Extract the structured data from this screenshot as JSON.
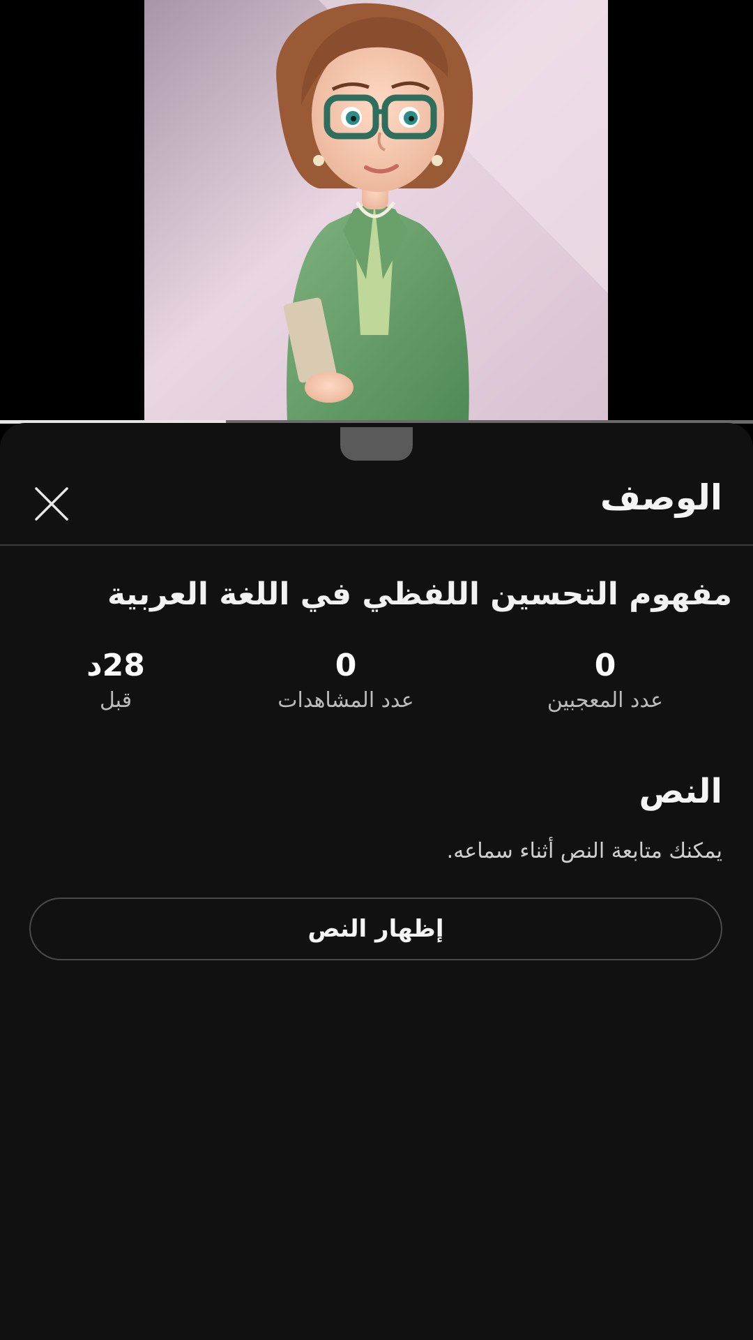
{
  "video": {
    "progress_fraction": 0.3
  },
  "sheet": {
    "title": "الوصف",
    "close_icon": "close-icon"
  },
  "details": {
    "video_title": "مفهوم التحسين اللفظي في اللغة العربية",
    "stats": [
      {
        "value": "0",
        "label": "عدد المعجبين"
      },
      {
        "value": "0",
        "label": "عدد المشاهدات"
      },
      {
        "value": "28د",
        "label": "قبل"
      }
    ]
  },
  "transcript": {
    "title": "النص",
    "description": "يمكنك متابعة النص أثناء سماعه.",
    "button_label": "إظهار النص"
  }
}
